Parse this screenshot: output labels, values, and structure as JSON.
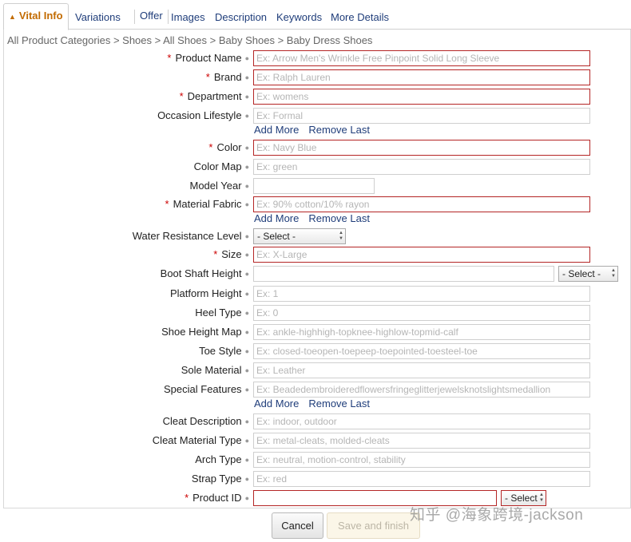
{
  "tabs": [
    {
      "label": "Vital Info",
      "active": true
    },
    {
      "label": "Variations"
    },
    {
      "label": "Offer"
    },
    {
      "label": "Images"
    },
    {
      "label": "Description"
    },
    {
      "label": "Keywords"
    },
    {
      "label": "More Details"
    }
  ],
  "breadcrumb": "All Product Categories > Shoes > All Shoes > Baby Shoes > Baby Dress Shoes",
  "fields": {
    "product_name": {
      "label": "Product Name",
      "placeholder": "Ex: Arrow Men's Wrinkle Free Pinpoint Solid Long Sleeve"
    },
    "brand": {
      "label": "Brand",
      "placeholder": "Ex: Ralph Lauren"
    },
    "department": {
      "label": "Department",
      "placeholder": "Ex: womens"
    },
    "occasion_lifestyle": {
      "label": "Occasion Lifestyle",
      "placeholder": "Ex: Formal"
    },
    "color": {
      "label": "Color",
      "placeholder": "Ex: Navy Blue"
    },
    "color_map": {
      "label": "Color Map",
      "placeholder": "Ex: green"
    },
    "model_year": {
      "label": "Model Year",
      "placeholder": ""
    },
    "material_fabric": {
      "label": "Material Fabric",
      "placeholder": "Ex: 90% cotton/10% rayon"
    },
    "water_resistance_level": {
      "label": "Water Resistance Level",
      "selected": "- Select -"
    },
    "size": {
      "label": "Size",
      "placeholder": "Ex: X-Large"
    },
    "boot_shaft_height": {
      "label": "Boot Shaft Height",
      "placeholder": "",
      "unit_selected": "- Select -"
    },
    "platform_height": {
      "label": "Platform Height",
      "placeholder": "Ex: 1"
    },
    "heel_type": {
      "label": "Heel Type",
      "placeholder": "Ex: 0"
    },
    "shoe_height_map": {
      "label": "Shoe Height Map",
      "placeholder": "Ex: ankle-highhigh-topknee-highlow-topmid-calf"
    },
    "toe_style": {
      "label": "Toe Style",
      "placeholder": "Ex: closed-toeopen-toepeep-toepointed-toesteel-toe"
    },
    "sole_material": {
      "label": "Sole Material",
      "placeholder": "Ex: Leather"
    },
    "special_features": {
      "label": "Special Features",
      "placeholder": "Ex: Beadedembroideredflowersfringeglitterjewelsknotslightsmedallion"
    },
    "cleat_description": {
      "label": "Cleat Description",
      "placeholder": "Ex: indoor, outdoor"
    },
    "cleat_material_type": {
      "label": "Cleat Material Type",
      "placeholder": "Ex: metal-cleats, molded-cleats"
    },
    "arch_type": {
      "label": "Arch Type",
      "placeholder": "Ex: neutral, motion-control, stability"
    },
    "strap_type": {
      "label": "Strap Type",
      "placeholder": "Ex: red"
    },
    "product_id": {
      "label": "Product ID",
      "placeholder": "",
      "type_selected": "- Select -"
    }
  },
  "links": {
    "add_more": "Add More",
    "remove_last": "Remove Last"
  },
  "required_mark": "*",
  "buttons": {
    "cancel": "Cancel",
    "save": "Save and finish"
  },
  "watermark": "知乎 @海象跨境-jackson",
  "colors": {
    "tab_active": "#c26b00",
    "link": "#1f3d7a",
    "required_border": "#b42525",
    "required_star": "#cc0000"
  }
}
